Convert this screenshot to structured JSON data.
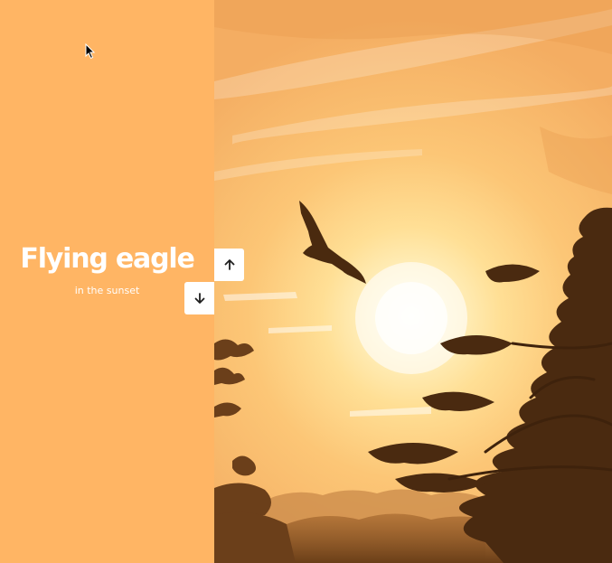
{
  "colors": {
    "left_panel": "#ffb564",
    "sky_light": "#ffe9b0",
    "sky_warm": "#f9b96a",
    "silhouette": "#5a3516",
    "button_bg": "#ffffff",
    "button_icon": "#1f1f1f"
  },
  "slide": {
    "title": "Flying eagle",
    "subtitle": "in the sunset",
    "image_subject": "eagle flying over trees in sunset"
  },
  "controls": {
    "up_icon": "arrow-up-icon",
    "down_icon": "arrow-down-icon"
  }
}
